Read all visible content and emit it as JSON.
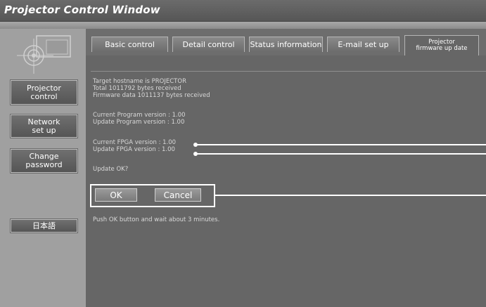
{
  "window": {
    "title": "Projector Control Window"
  },
  "sidebar": {
    "items": [
      {
        "label_line1": "Projector",
        "label_line2": "control"
      },
      {
        "label_line1": "Network",
        "label_line2": "set up"
      },
      {
        "label_line1": "Change",
        "label_line2": "password"
      },
      {
        "label_line1": "日本語",
        "label_line2": ""
      }
    ]
  },
  "tabs": [
    {
      "label": "Basic control"
    },
    {
      "label": "Detail control"
    },
    {
      "label": "Status information"
    },
    {
      "label": "E-mail set up"
    },
    {
      "label_line1": "Projector",
      "label_line2": "firmware up date"
    }
  ],
  "messages": {
    "hostname": "Target hostname is PROJECTOR",
    "total_received": "Total 1011792 bytes received",
    "firmware_received": "Firmware data 1011137 bytes received",
    "current_program": "Current Program version : 1.00",
    "update_program": "Update Program version : 1.00",
    "current_fpga": "Current FPGA version : 1.00",
    "update_fpga": "Update FPGA version : 1.00",
    "confirm": "Update OK?",
    "instruction": "Push OK button and wait about 3 minutes."
  },
  "buttons": {
    "ok": "OK",
    "cancel": "Cancel"
  }
}
